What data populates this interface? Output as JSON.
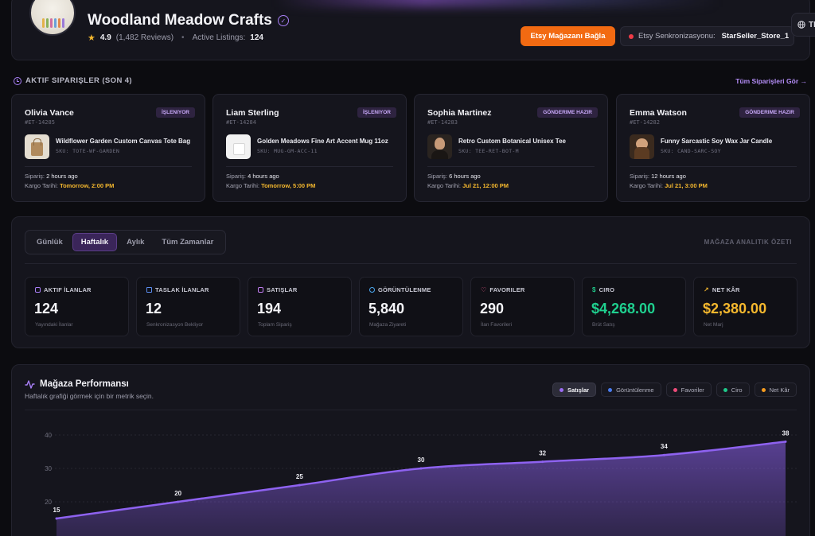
{
  "store": {
    "name": "Woodland Meadow Crafts",
    "rating": "4.9",
    "reviews": "(1,482 Reviews)",
    "listings_label": "Active Listings:",
    "listings_value": "124",
    "connect_label": "Etsy Mağazanı Bağla",
    "sync_label": "Etsy Senkronizasyonu:",
    "sync_store": "StarSeller_Store_1",
    "lang_label": "TR"
  },
  "orders": {
    "title": "AKTIF SIPARIŞLER (SON 4)",
    "view_all": "Tüm Siparişleri Gör →",
    "items": [
      {
        "customer": "Olivia Vance",
        "id": "#ET-14285",
        "status": "İŞLENIYOR",
        "product": "Wildflower Garden Custom Canvas Tote Bag",
        "sku": "SKU: TOTE-WF-GARDEN",
        "order_label": "Sipariş:",
        "order_time": "2 hours ago",
        "ship_label": "Kargo Tarihi:",
        "ship_time": "Tomorrow, 2:00 PM"
      },
      {
        "customer": "Liam Sterling",
        "id": "#ET-14284",
        "status": "İŞLENIYOR",
        "product": "Golden Meadows Fine Art Accent Mug 11oz",
        "sku": "SKU: MUG-GM-ACC-11",
        "order_label": "Sipariş:",
        "order_time": "4 hours ago",
        "ship_label": "Kargo Tarihi:",
        "ship_time": "Tomorrow, 5:00 PM"
      },
      {
        "customer": "Sophia Martinez",
        "id": "#ET-14283",
        "status": "GÖNDERIME HAZIR",
        "product": "Retro Custom Botanical Unisex Tee",
        "sku": "SKU: TEE-RET-BOT-M",
        "order_label": "Sipariş:",
        "order_time": "6 hours ago",
        "ship_label": "Kargo Tarihi:",
        "ship_time": "Jul 21, 12:00 PM"
      },
      {
        "customer": "Emma Watson",
        "id": "#ET-14282",
        "status": "GÖNDERIME HAZIR",
        "product": "Funny Sarcastic Soy Wax Jar Candle",
        "sku": "SKU: CAND-SARC-SOY",
        "order_label": "Sipariş:",
        "order_time": "12 hours ago",
        "ship_label": "Kargo Tarihi:",
        "ship_time": "Jul 21, 3:00 PM"
      }
    ]
  },
  "analytics": {
    "tabs": [
      "Günlük",
      "Haftalık",
      "Aylık",
      "Tüm Zamanlar"
    ],
    "active_tab": "Haftalık",
    "label": "MAĞAZA ANALITIK ÖZETI",
    "stats": [
      {
        "label": "AKTIF İLANLAR",
        "value": "124",
        "sub": "Yayındaki İlanlar",
        "icon": "box-icon",
        "color": "#a77ef5",
        "value_color": "#f4f4f8"
      },
      {
        "label": "TASLAK İLANLAR",
        "value": "12",
        "sub": "Senkronizasyon Bekliyor",
        "icon": "document-icon",
        "color": "#5b8def",
        "value_color": "#f4f4f8"
      },
      {
        "label": "SATIŞLAR",
        "value": "194",
        "sub": "Toplam Sipariş",
        "icon": "bag-icon",
        "color": "#c07cf0",
        "value_color": "#f4f4f8"
      },
      {
        "label": "GÖRÜNTÜLENME",
        "value": "5,840",
        "sub": "Mağaza Ziyareti",
        "icon": "eye-icon",
        "color": "#4aa8f0",
        "value_color": "#f4f4f8"
      },
      {
        "label": "FAVORILER",
        "value": "290",
        "sub": "İlan Favorileri",
        "icon": "heart-icon",
        "color": "#ee5c8a",
        "value_color": "#f4f4f8"
      },
      {
        "label": "CIRO",
        "value": "$4,268.00",
        "sub": "Brüt Satış",
        "icon": "dollar-icon",
        "color": "#1fc98a",
        "value_color": "#1fd08f"
      },
      {
        "label": "NET KÂR",
        "value": "$2,380.00",
        "sub": "Net Marj",
        "icon": "trend-up-icon",
        "color": "#f5b82e",
        "value_color": "#f5b82e"
      }
    ]
  },
  "performance": {
    "title": "Mağaza Performansı",
    "subtitle": "Haftalık grafiği görmek için bir metrik seçin.",
    "metrics": [
      {
        "label": "Satışlar",
        "color": "#9b6cf2"
      },
      {
        "label": "Görüntülenme",
        "color": "#4a7df0"
      },
      {
        "label": "Favoriler",
        "color": "#ee4c7a"
      },
      {
        "label": "Ciro",
        "color": "#1fc98a"
      },
      {
        "label": "Net Kâr",
        "color": "#f59b1f"
      }
    ],
    "active_metric": "Satışlar"
  },
  "chart_data": {
    "type": "area",
    "series": [
      {
        "values": [
          15,
          20,
          25,
          30,
          32,
          34,
          38
        ]
      }
    ],
    "y_ticks": [
      "40",
      "30",
      "20"
    ],
    "ylim": [
      10,
      40
    ],
    "grid": true,
    "color": "#8e62f0"
  }
}
